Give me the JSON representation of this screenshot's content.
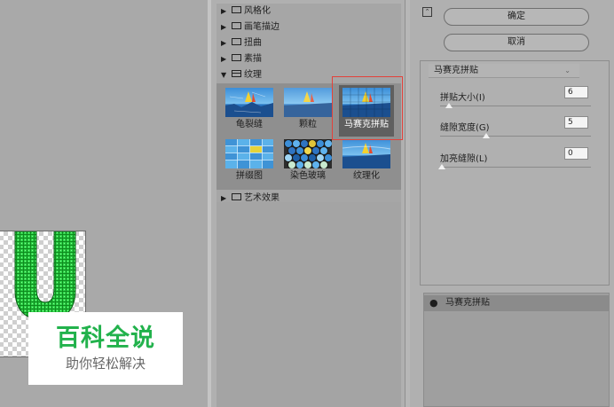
{
  "gallery": {
    "categories_top": [
      {
        "label": "风格化",
        "expanded": false
      },
      {
        "label": "画笔描边",
        "expanded": false
      },
      {
        "label": "扭曲",
        "expanded": false
      },
      {
        "label": "素描",
        "expanded": false
      }
    ],
    "open_category": {
      "label": "纹理",
      "expanded": true
    },
    "filters": [
      {
        "label": "龟裂缝",
        "icon": "craquelure-thumb"
      },
      {
        "label": "颗粒",
        "icon": "grain-thumb"
      },
      {
        "label": "马赛克拼贴",
        "icon": "mosaic-tiles-thumb",
        "selected": true
      },
      {
        "label": "拼缀图",
        "icon": "patchwork-thumb"
      },
      {
        "label": "染色玻璃",
        "icon": "stained-glass-thumb"
      },
      {
        "label": "纹理化",
        "icon": "texturizer-thumb"
      }
    ],
    "categories_bottom": [
      {
        "label": "艺术效果",
        "expanded": false
      }
    ]
  },
  "settings": {
    "ok_label": "确定",
    "cancel_label": "取消",
    "filter_select": "马赛克拼贴",
    "params": [
      {
        "label": "拼贴大小(I)",
        "value": "6",
        "level": 0.05
      },
      {
        "label": "缝隙宽度(G)",
        "value": "5",
        "level": 0.3
      },
      {
        "label": "加亮缝隙(L)",
        "value": "0",
        "level": 0.0
      }
    ],
    "layer_name": "马赛克拼贴"
  },
  "watermark": {
    "title": "百科全说",
    "subtitle": "助你轻松解决"
  },
  "colors": {
    "selection_outline": "#e3413a",
    "watermark_green": "#22b24c"
  }
}
